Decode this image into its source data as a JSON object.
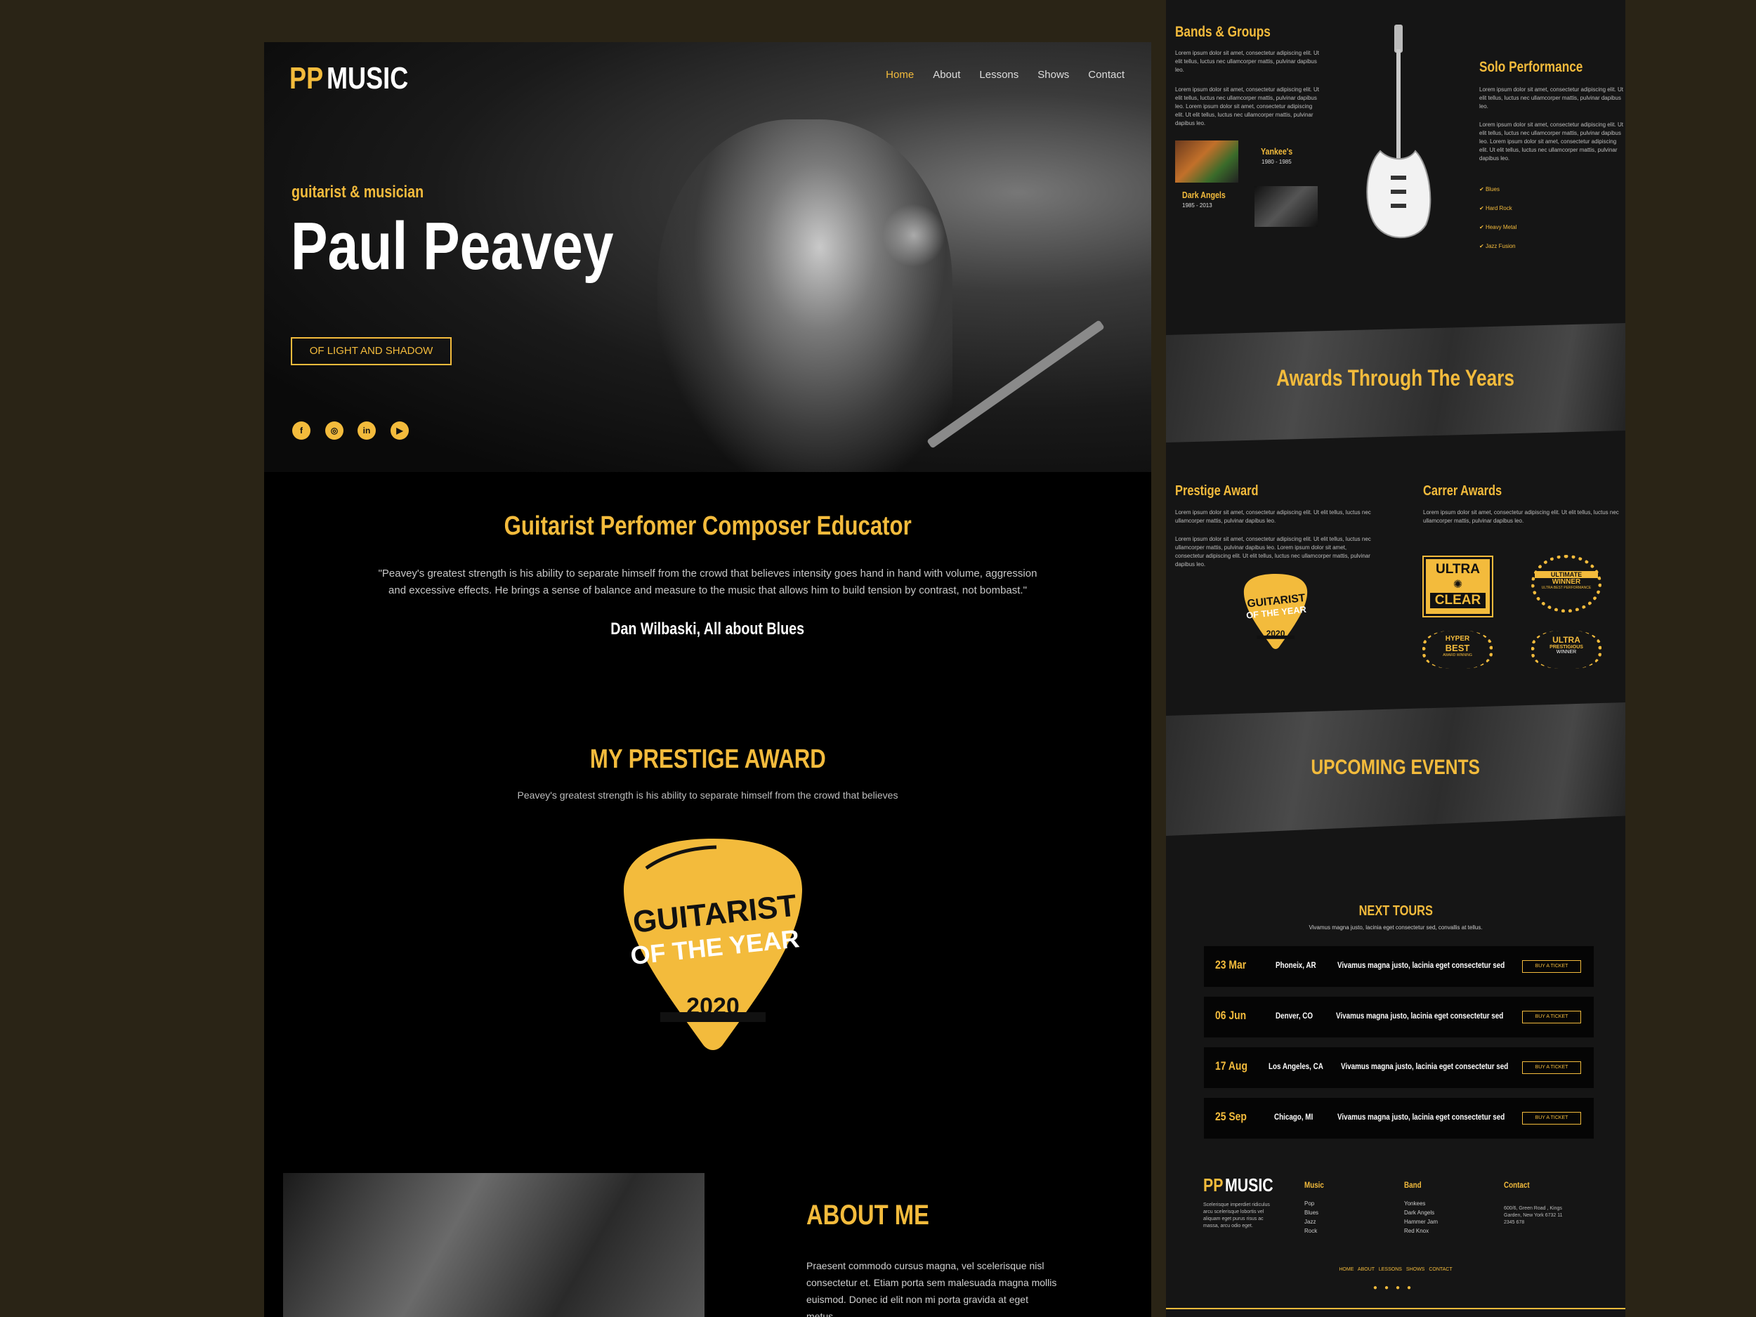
{
  "brand": {
    "pp": "PP",
    "music": "MUSIC"
  },
  "nav": {
    "items": [
      "Home",
      "About",
      "Lessons",
      "Shows",
      "Contact"
    ]
  },
  "hero": {
    "subtitle": "guitarist & musician",
    "name": "Paul Peavey",
    "cta": "OF LIGHT AND SHADOW",
    "social": [
      "facebook-icon",
      "instagram-icon",
      "linkedin-icon",
      "youtube-icon"
    ]
  },
  "quote": {
    "heading": "Guitarist Perfomer Composer Educator",
    "text": "\"Peavey's greatest strength is his ability to separate himself from the crowd that believes intensity goes hand in hand with volume, aggression and excessive effects. He brings a sense of balance and measure to the music that allows him to build tension by contrast, not bombast.\"",
    "author": "Dan Wilbaski, All about Blues"
  },
  "award": {
    "heading": "MY PRESTIGE AWARD",
    "sub": "Peavey's greatest strength is his ability to separate himself from the crowd that believes",
    "pick_line1": "GUITARIST",
    "pick_line2": "OF THE YEAR",
    "pick_year": "2020"
  },
  "about": {
    "heading": "ABOUT ME",
    "text": "Praesent commodo cursus magna, vel scelerisque nisl consectetur et. Etiam porta sem malesuada magna mollis euismod. Donec id elit non mi porta gravida at eget metus."
  },
  "bands": {
    "heading": "Bands & Groups",
    "p1": "Lorem ipsum dolor sit amet, consectetur adipiscing elit. Ut elit tellus, luctus nec ullamcorper mattis, pulvinar dapibus leo.",
    "p2": "Lorem ipsum dolor sit amet, consectetur adipiscing elit. Ut elit tellus, luctus nec ullamcorper mattis, pulvinar dapibus leo. Lorem ipsum dolor sit amet, consectetur adipiscing elit. Ut elit tellus, luctus nec ullamcorper mattis, pulvinar dapibus leo.",
    "b1_name": "Yankee's",
    "b1_years": "1980 - 1985",
    "b2_name": "Dark Angels",
    "b2_years": "1985 - 2013"
  },
  "solo": {
    "heading": "Solo Performance",
    "p1": "Lorem ipsum dolor sit amet, consectetur adipiscing elit. Ut elit tellus, luctus nec ullamcorper mattis, pulvinar dapibus leo.",
    "p2": "Lorem ipsum dolor sit amet, consectetur adipiscing elit. Ut elit tellus, luctus nec ullamcorper mattis, pulvinar dapibus leo. Lorem ipsum dolor sit amet, consectetur adipiscing elit. Ut elit tellus, luctus nec ullamcorper mattis, pulvinar dapibus leo.",
    "genres": [
      "Blues",
      "Hard Rock",
      "Heavy Metal",
      "Jazz Fusion"
    ]
  },
  "awards_banner": "Awards Through The Years",
  "prestige": {
    "heading": "Prestige Award",
    "p1": "Lorem ipsum dolor sit amet, consectetur adipiscing elit. Ut elit tellus, luctus nec ullamcorper mattis, pulvinar dapibus leo.",
    "p2": "Lorem ipsum dolor sit amet, consectetur adipiscing elit. Ut elit tellus, luctus nec ullamcorper mattis, pulvinar dapibus leo. Lorem ipsum dolor sit amet, consectetur adipiscing elit. Ut elit tellus, luctus nec ullamcorper mattis, pulvinar dapibus leo.",
    "pick_line1": "GUITARIST",
    "pick_line2": "OF THE YEAR",
    "pick_year": "2020"
  },
  "career": {
    "heading": "Carrer Awards",
    "p1": "Lorem ipsum dolor sit amet, consectetur adipiscing elit. Ut elit tellus, luctus nec ullamcorper mattis, pulvinar dapibus leo.",
    "badge1_a": "ULTRA",
    "badge1_b": "CLEAR",
    "badge2_a": "ULTIMATE",
    "badge2_b": "WINNER",
    "badge2_c": "ULTRA BEST PERFORMANCE",
    "badge3_a": "HYPER",
    "badge3_b": "BEST",
    "badge3_c": "AWARD WINNING",
    "badge4_a": "ULTRA",
    "badge4_b": "PRESTIGIOUS",
    "badge4_c": "WINNER"
  },
  "events_banner": "UPCOMING EVENTS",
  "tours": {
    "heading": "NEXT TOURS",
    "sub": "Vivamus magna justo, lacinia eget consectetur sed, convallis at tellus.",
    "rows": [
      {
        "date": "23 Mar",
        "city": "Phoneix, AR",
        "desc": "Vivamus magna justo, lacinia eget consectetur sed",
        "btn": "BUY A TICKET"
      },
      {
        "date": "06 Jun",
        "city": "Denver, CO",
        "desc": "Vivamus magna justo, lacinia eget consectetur sed",
        "btn": "BUY A TICKET"
      },
      {
        "date": "17 Aug",
        "city": "Los Angeles, CA",
        "desc": "Vivamus magna justo, lacinia eget consectetur sed",
        "btn": "BUY A TICKET"
      },
      {
        "date": "25 Sep",
        "city": "Chicago, MI",
        "desc": "Vivamus magna justo, lacinia eget consectetur sed",
        "btn": "BUY A TICKET"
      }
    ]
  },
  "footer": {
    "about": "Scelerisque imperdiet ridiculus arcu scelerisque lobortis vel aliquam eget purus risus ac massa, arcu odio eget.",
    "music_h": "Music",
    "music": [
      "Pop",
      "Blues",
      "Jazz",
      "Rock"
    ],
    "band_h": "Band",
    "band": [
      "Yonkees",
      "Dark Angels",
      "Hammer Jam",
      "Red Knox"
    ],
    "contact_h": "Contact",
    "contact": "600/6, Green Road , Kings Garden, New York 6732 11 2345 678",
    "links": [
      "HOME",
      "ABOUT",
      "LESSONS",
      "SHOWS",
      "CONTACT"
    ]
  },
  "colors": {
    "accent": "#f3bb3c",
    "bg": "#000000",
    "outer": "#2a2416"
  }
}
